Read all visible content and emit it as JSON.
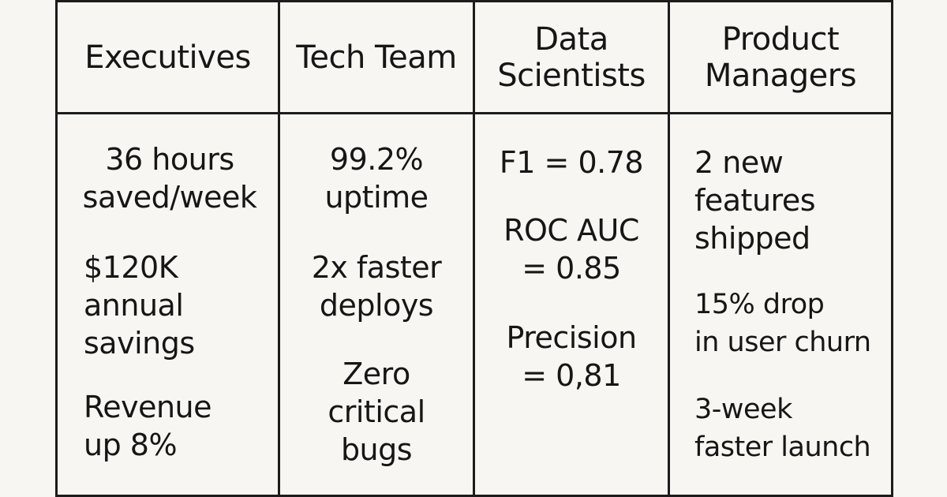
{
  "columns": [
    {
      "header": "Executives",
      "metrics": [
        "36 hours\nsaved/week",
        "$120K\nannual\nsavings",
        "Revenue\nup 8%"
      ]
    },
    {
      "header": "Tech Team",
      "metrics": [
        "99.2%\nuptime",
        "2x faster\ndeploys",
        "Zero\ncritical\nbugs"
      ]
    },
    {
      "header": "Data\nScientists",
      "metrics": [
        "F1 = 0.78",
        "ROC AUC\n= 0.85",
        "Precision\n= 0,81"
      ]
    },
    {
      "header": "Product\nManagers",
      "metrics": [
        "2 new\nfeatures\nshipped",
        "15% drop\nin user churn",
        "3-week\nfaster launch"
      ]
    }
  ]
}
